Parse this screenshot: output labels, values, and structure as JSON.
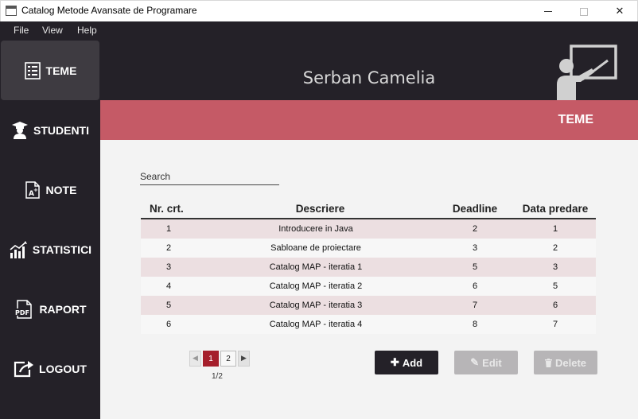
{
  "window": {
    "title": "Catalog Metode Avansate de Programare"
  },
  "menu": {
    "file": "File",
    "view": "View",
    "help": "Help"
  },
  "sidebar": {
    "items": [
      {
        "label": "TEME",
        "icon": "list-icon"
      },
      {
        "label": "STUDENTI",
        "icon": "student-icon"
      },
      {
        "label": "NOTE",
        "icon": "grade-doc-icon"
      },
      {
        "label": "STATISTICI",
        "icon": "chart-icon"
      },
      {
        "label": "RAPORT",
        "icon": "pdf-icon"
      },
      {
        "label": "LOGOUT",
        "icon": "logout-icon"
      }
    ]
  },
  "header": {
    "user_name": "Serban Camelia",
    "icon": "teacher-board-icon"
  },
  "section": {
    "title": "TEME"
  },
  "search": {
    "placeholder": "Search",
    "value": ""
  },
  "table": {
    "headers": [
      "Nr. crt.",
      "Descriere",
      "Deadline",
      "Data predare"
    ],
    "rows": [
      [
        "1",
        "Introducere in Java",
        "2",
        "1"
      ],
      [
        "2",
        "Sabloane de proiectare",
        "3",
        "2"
      ],
      [
        "3",
        "Catalog MAP - iteratia 1",
        "5",
        "3"
      ],
      [
        "4",
        "Catalog MAP - iteratia 2",
        "6",
        "5"
      ],
      [
        "5",
        "Catalog MAP - iteratia 3",
        "7",
        "6"
      ],
      [
        "6",
        "Catalog MAP - iteratia 4",
        "8",
        "7"
      ]
    ]
  },
  "pagination": {
    "pages": [
      "1",
      "2"
    ],
    "current": "1",
    "info": "1/2"
  },
  "actions": {
    "add": "Add",
    "edit": "Edit",
    "delete": "Delete"
  },
  "colors": {
    "sidebar": "#242128",
    "accent": "#c55a66",
    "active_page": "#a51e2b",
    "row_alt": "#ecdfe1"
  }
}
